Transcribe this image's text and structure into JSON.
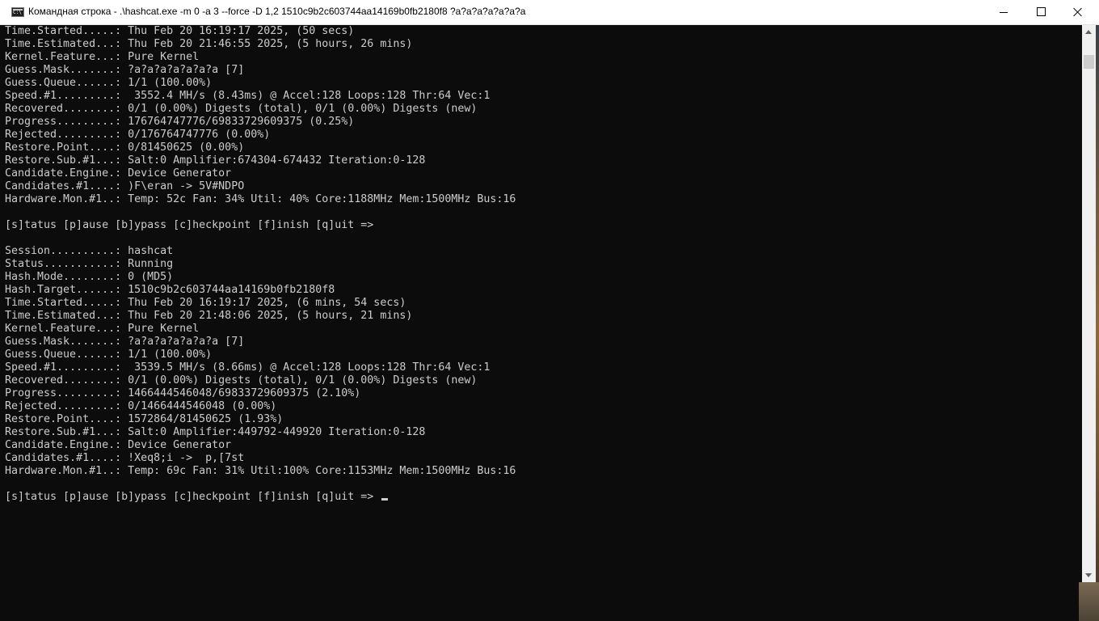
{
  "window": {
    "title": "Командная строка - .\\hashcat.exe  -m 0 -a 3 --force -D 1,2 1510c9b2c603744aa14169b0fb2180f8 ?a?a?a?a?a?a?a"
  },
  "console": {
    "lines": [
      "Time.Started.....: Thu Feb 20 16:19:17 2025, (50 secs)",
      "Time.Estimated...: Thu Feb 20 21:46:55 2025, (5 hours, 26 mins)",
      "Kernel.Feature...: Pure Kernel",
      "Guess.Mask.......: ?a?a?a?a?a?a?a [7]",
      "Guess.Queue......: 1/1 (100.00%)",
      "Speed.#1.........:  3552.4 MH/s (8.43ms) @ Accel:128 Loops:128 Thr:64 Vec:1",
      "Recovered........: 0/1 (0.00%) Digests (total), 0/1 (0.00%) Digests (new)",
      "Progress.........: 176764747776/69833729609375 (0.25%)",
      "Rejected.........: 0/176764747776 (0.00%)",
      "Restore.Point....: 0/81450625 (0.00%)",
      "Restore.Sub.#1...: Salt:0 Amplifier:674304-674432 Iteration:0-128",
      "Candidate.Engine.: Device Generator",
      "Candidates.#1....: )F\\eran -> 5V#NDPO",
      "Hardware.Mon.#1..: Temp: 52c Fan: 34% Util: 40% Core:1188MHz Mem:1500MHz Bus:16",
      "",
      "[s]tatus [p]ause [b]ypass [c]heckpoint [f]inish [q]uit =>",
      "",
      "Session..........: hashcat",
      "Status...........: Running",
      "Hash.Mode........: 0 (MD5)",
      "Hash.Target......: 1510c9b2c603744aa14169b0fb2180f8",
      "Time.Started.....: Thu Feb 20 16:19:17 2025, (6 mins, 54 secs)",
      "Time.Estimated...: Thu Feb 20 21:48:06 2025, (5 hours, 21 mins)",
      "Kernel.Feature...: Pure Kernel",
      "Guess.Mask.......: ?a?a?a?a?a?a?a [7]",
      "Guess.Queue......: 1/1 (100.00%)",
      "Speed.#1.........:  3539.5 MH/s (8.66ms) @ Accel:128 Loops:128 Thr:64 Vec:1",
      "Recovered........: 0/1 (0.00%) Digests (total), 0/1 (0.00%) Digests (new)",
      "Progress.........: 1466444546048/69833729609375 (2.10%)",
      "Rejected.........: 0/1466444546048 (0.00%)",
      "Restore.Point....: 1572864/81450625 (1.93%)",
      "Restore.Sub.#1...: Salt:0 Amplifier:449792-449920 Iteration:0-128",
      "Candidate.Engine.: Device Generator",
      "Candidates.#1....: !Xeq8;i ->  p,[7st",
      "Hardware.Mon.#1..: Temp: 69c Fan: 31% Util:100% Core:1153MHz Mem:1500MHz Bus:16",
      ""
    ],
    "prompt": "[s]tatus [p]ause [b]ypass [c]heckpoint [f]inish [q]uit => "
  }
}
